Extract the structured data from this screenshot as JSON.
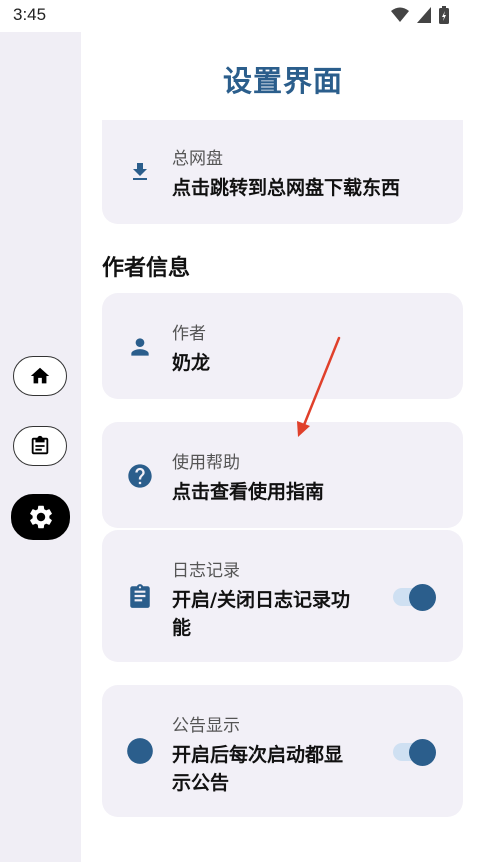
{
  "status_bar": {
    "time": "3:45"
  },
  "header": {
    "title": "设置界面"
  },
  "cards": {
    "download": {
      "label": "总网盘",
      "value": "点击跳转到总网盘下载东西"
    },
    "author": {
      "label": "作者",
      "value": "奶龙"
    },
    "help": {
      "label": "使用帮助",
      "value": "点击查看使用指南"
    },
    "log": {
      "label": "日志记录",
      "value_line1": "开启/关闭日志记录功",
      "value_line2": "能",
      "enabled": true
    },
    "notice": {
      "label": "公告显示",
      "value_line1": "开启后每次启动都显",
      "value_line2": "示公告",
      "enabled": true
    }
  },
  "sections": {
    "author_info": "作者信息"
  },
  "navigation": {
    "items": [
      {
        "icon": "home-icon"
      },
      {
        "icon": "clipboard-icon"
      },
      {
        "icon": "settings-icon",
        "active": true
      }
    ]
  },
  "colors": {
    "accent": "#2b5e8c",
    "card_bg": "#f2f0f7",
    "rail_bg": "#f0eef5",
    "arrow": "#e0402b"
  }
}
